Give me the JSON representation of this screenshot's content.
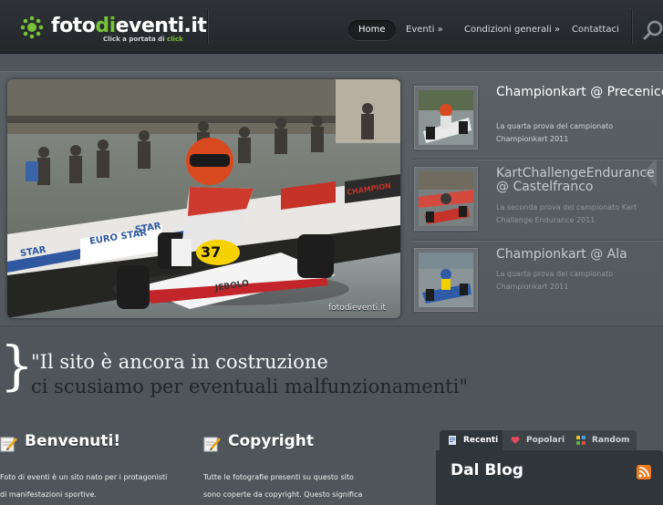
{
  "brand": {
    "name_part1": "foto",
    "name_accent": "di",
    "name_part2": "eventi.it",
    "tagline_main": "Click a portata di",
    "tagline_accent": "click",
    "accent_color": "#78c238"
  },
  "nav": {
    "items": [
      {
        "label": "Home",
        "active": true
      },
      {
        "label": "Eventi »",
        "active": false
      },
      {
        "label": "Condizioni generali »",
        "active": false
      },
      {
        "label": "Contattaci",
        "active": false
      }
    ],
    "search_icon": "search-icon"
  },
  "featured": {
    "photo_credit": "fotodieventi.it",
    "kart_number": "37",
    "kart_brand": "JEBOLO",
    "banners": [
      "STAR",
      "EURO STAR",
      "STAR",
      "CHAMPION"
    ],
    "slides": [
      {
        "title": "Championkart @ Precenicco",
        "description": "La quarta prova del campionato Championkart 2011"
      },
      {
        "title": "KartChallengeEndurance @ Castelfranco",
        "description": "La seconda prova del campionato Kart Challenge Endurance 2011"
      },
      {
        "title": "Championkart @ Ala",
        "description": "La quarta prova del campionato Championkart 2011"
      }
    ]
  },
  "quote": {
    "brace": "}",
    "line1": "\"Il sito è ancora in costruzione",
    "line2": "ci scusiamo per eventuali malfunzionamenti\""
  },
  "columns": [
    {
      "title": "Benvenuti!",
      "text_line1": "Foto di eventi è un sito nato per i protagonisti",
      "text_line2": "di manifestazioni sportive."
    },
    {
      "title": "Copyright",
      "text_line1": "Tutte le fotografie presenti su questo sito",
      "text_line2": "sono coperte da copyright. Questo significa"
    }
  ],
  "blog": {
    "tabs": [
      {
        "label": "Recenti",
        "icon": "document-icon",
        "active": true
      },
      {
        "label": "Popolari",
        "icon": "heart-icon",
        "active": false
      },
      {
        "label": "Random",
        "icon": "shuffle-icon",
        "active": false
      }
    ],
    "title": "Dal Blog",
    "rss_icon": "rss-icon"
  }
}
